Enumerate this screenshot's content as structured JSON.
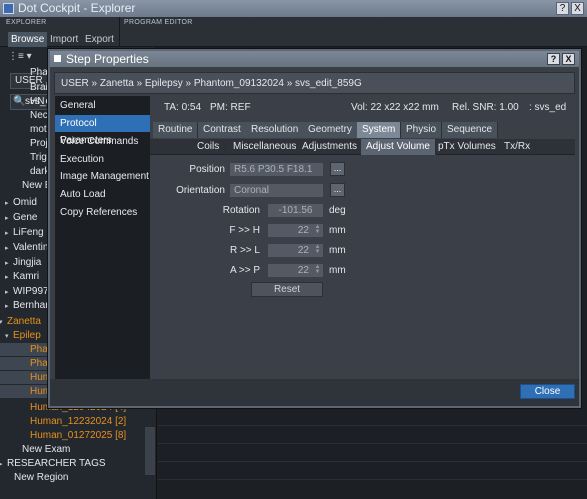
{
  "window": {
    "title": "Dot Cockpit - Explorer",
    "help": "?",
    "close": "X"
  },
  "panels": {
    "explorer_title": "EXPLORER",
    "program_editor_title": "PROGRAM EDITOR"
  },
  "explorer_tabs": [
    "Browse",
    "Import",
    "Export"
  ],
  "explorer_filter": "USER",
  "explorer_search": "svs_e",
  "tree": [
    {
      "label": "Pha",
      "color": "white"
    },
    {
      "label": "Brai",
      "color": "white"
    },
    {
      "label": "HN",
      "color": "white"
    },
    {
      "label": "Nec",
      "color": "white"
    },
    {
      "label": "moti",
      "color": "white"
    },
    {
      "label": "Proj",
      "color": "white"
    },
    {
      "label": "Trig",
      "color": "white"
    },
    {
      "label": "dark",
      "color": "white"
    },
    {
      "label": "New E",
      "color": "white"
    },
    {
      "label": "Omid",
      "color": "white"
    },
    {
      "label": "Gene",
      "color": "white"
    },
    {
      "label": "LiFeng",
      "color": "white"
    },
    {
      "label": "Valentin",
      "color": "white"
    },
    {
      "label": "Jingjia",
      "color": "white"
    },
    {
      "label": "Kamri",
      "color": "white"
    },
    {
      "label": "WIP997",
      "color": "white"
    },
    {
      "label": "Bernhar",
      "color": "white"
    },
    {
      "label": "Zanetta",
      "color": "orange"
    },
    {
      "label": "Epilep",
      "color": "orange"
    },
    {
      "label": "Pha",
      "color": "orange"
    },
    {
      "label": "Pha",
      "color": "orange"
    },
    {
      "label": "Hum",
      "color": "orange"
    },
    {
      "label": "Hum",
      "color": "orange"
    },
    {
      "label": "Human_12042024 [4]",
      "color": "orange"
    },
    {
      "label": "Human_12232024 [2]",
      "color": "orange"
    },
    {
      "label": "Human_01272025 [8]",
      "color": "orange"
    },
    {
      "label": "New Exam",
      "color": "white"
    },
    {
      "label": "RESEARCHER TAGS",
      "color": "white"
    },
    {
      "label": "New Region",
      "color": "white"
    }
  ],
  "dialog": {
    "title": "Step Properties",
    "help": "?",
    "close": "X",
    "breadcrumb": "USER  »  Zanetta  »  Epilepsy  »  Phantom_09132024  »  svs_edit_859G",
    "nav": [
      "General",
      "Protocol Parameters",
      "Voice Commands",
      "Execution",
      "Image Management",
      "Auto Load",
      "Copy References"
    ],
    "info": {
      "ta": "TA: 0:54",
      "pm": "PM: REF",
      "vol": "Vol: 22 x22 x22 mm",
      "snr": "Rel. SNR: 1.00",
      "seq": ": svs_ed"
    },
    "tabs_primary": [
      "Routine",
      "Contrast",
      "Resolution",
      "Geometry",
      "System",
      "Physio",
      "Sequence"
    ],
    "tabs_secondary": [
      "Coils",
      "Miscellaneous",
      "Adjustments",
      "Adjust Volume",
      "pTx Volumes",
      "Tx/Rx"
    ],
    "fields": {
      "position_label": "Position",
      "position_value": "R5.6 P30.5 F18.1",
      "orientation_label": "Orientation",
      "orientation_value": "Coronal",
      "rotation_label": "Rotation",
      "rotation_value": "-101.56",
      "rotation_unit": "deg",
      "fh_label": "F >> H",
      "fh_value": "22",
      "rl_label": "R >> L",
      "rl_value": "22",
      "ap_label": "A >> P",
      "ap_value": "22",
      "mm": "mm",
      "dots": "..."
    },
    "reset": "Reset",
    "close_button": "Close"
  }
}
